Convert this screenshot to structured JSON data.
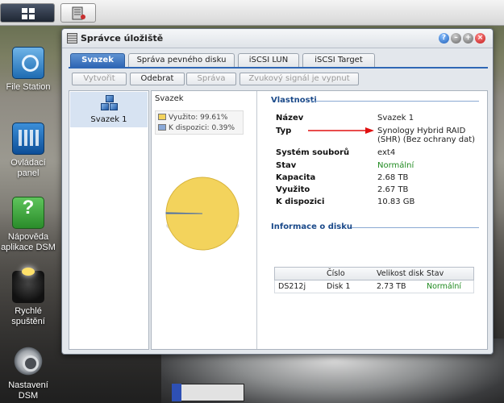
{
  "window": {
    "title": "Správce úložiště"
  },
  "tabs": [
    {
      "label": "Svazek"
    },
    {
      "label": "Správa pevného disku"
    },
    {
      "label": "iSCSI LUN"
    },
    {
      "label": "iSCSI Target"
    }
  ],
  "toolbar": {
    "create": "Vytvořit",
    "remove": "Odebrat",
    "manage": "Správa",
    "beep": "Zvukový signál je vypnut"
  },
  "volumes": [
    {
      "label": "Svazek 1"
    }
  ],
  "volume_panel": {
    "title": "Svazek",
    "used_label": "Využito: 99.61%",
    "free_label": "K dispozici: 0.39%",
    "used_percent": 99.61,
    "free_percent": 0.39,
    "used_color": "#f3d35c",
    "free_color": "#8aa9d8"
  },
  "properties": {
    "title": "Vlastnosti",
    "rows": [
      {
        "label": "Název",
        "value": "Svazek 1"
      },
      {
        "label": "Typ",
        "value": "Synology Hybrid RAID",
        "value2": "(SHR) (Bez ochrany dat)"
      },
      {
        "label": "Systém souborů",
        "value": "ext4"
      },
      {
        "label": "Stav",
        "value": "Normální"
      },
      {
        "label": "Kapacita",
        "value": "2.68 TB"
      },
      {
        "label": "Využito",
        "value": "2.67 TB"
      },
      {
        "label": "K dispozici",
        "value": "10.83 GB"
      }
    ]
  },
  "disk_info": {
    "title": "Informace o disku",
    "headers": [
      "",
      "Číslo",
      "Velikost disk",
      "Stav"
    ],
    "rows": [
      [
        "DS212j",
        "Disk 1",
        "2.73 TB",
        "Normální"
      ]
    ]
  },
  "desktop": {
    "icons": [
      {
        "label": "File Station"
      },
      {
        "label": "Ovládací",
        "label2": "panel"
      },
      {
        "label": "Nápověda",
        "label2": "aplikace DSM"
      },
      {
        "label": "Rychlé",
        "label2": "spuštění"
      },
      {
        "label": "Nastavení",
        "label2": "DSM"
      }
    ]
  },
  "icons": {
    "taskbar_home": "grid-icon",
    "taskbar_app": "storage-manager-icon",
    "volume": "cubes-icon",
    "annotation": "red-arrow"
  },
  "colors": {
    "accent": "#2f67b5",
    "status_ok": "#1f8a1f",
    "arrow": "#e01010"
  }
}
